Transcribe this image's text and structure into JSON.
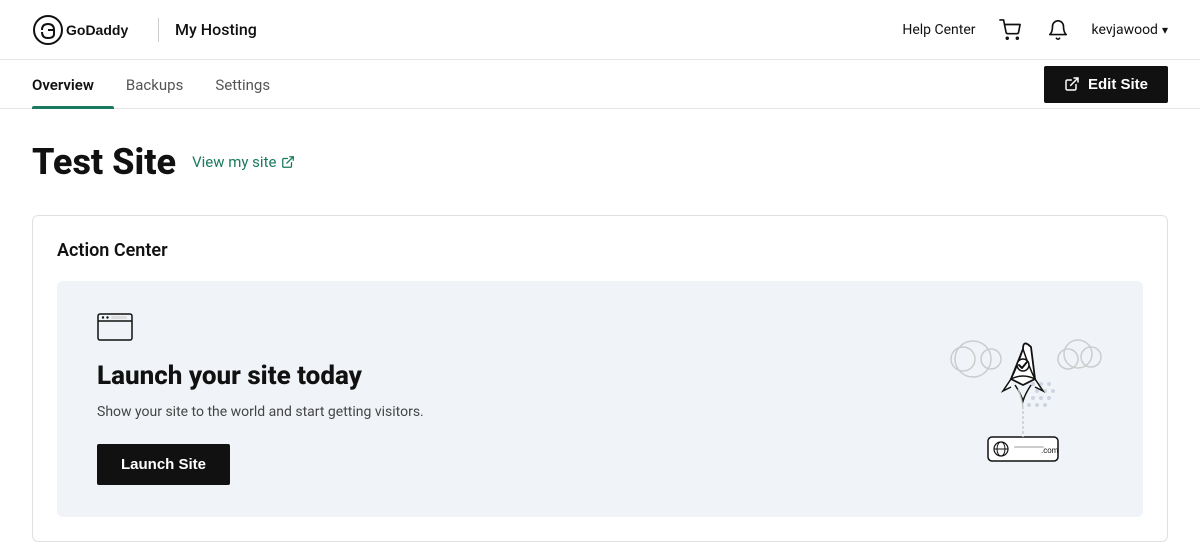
{
  "header": {
    "logo_alt": "GoDaddy",
    "my_hosting_label": "My Hosting",
    "help_center_label": "Help Center",
    "username": "kevjawood",
    "chevron": "▾"
  },
  "tabs": {
    "overview_label": "Overview",
    "backups_label": "Backups",
    "settings_label": "Settings",
    "edit_site_label": "Edit Site"
  },
  "page": {
    "site_title": "Test Site",
    "view_site_label": "View my site"
  },
  "action_center": {
    "title": "Action Center",
    "launch_title": "Launch your site today",
    "launch_desc": "Show your site to the world and start getting visitors.",
    "launch_btn_label": "Launch Site"
  }
}
